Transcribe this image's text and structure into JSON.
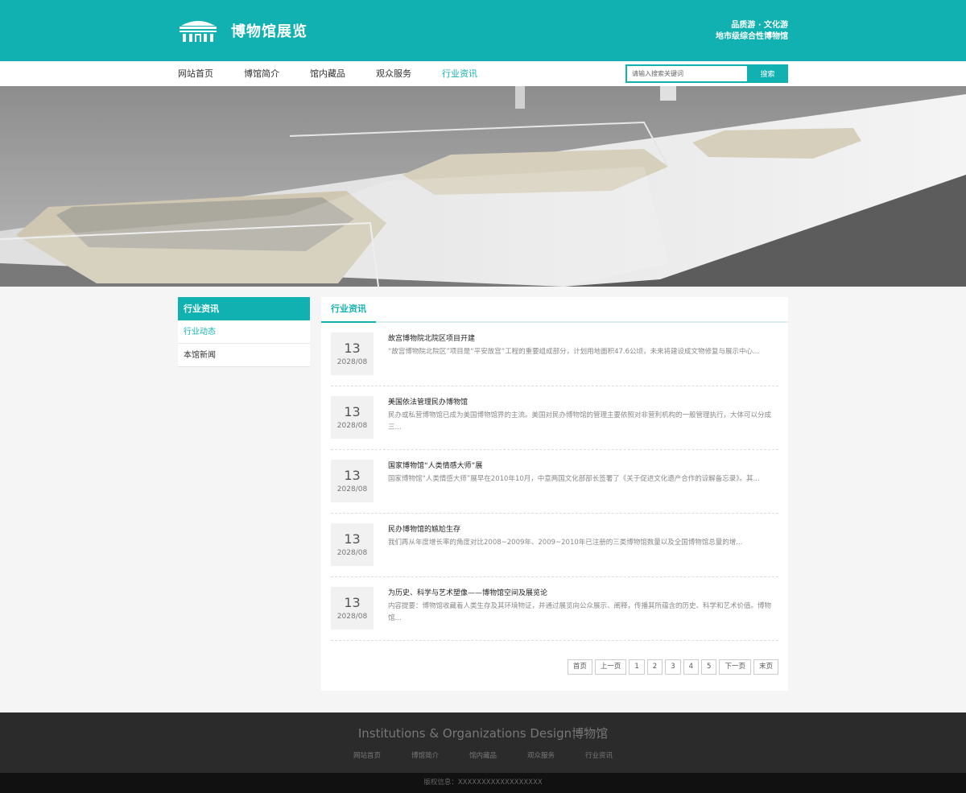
{
  "header": {
    "logo_title": "博物馆展览",
    "slogan_line1": "品质游 · 文化游",
    "slogan_line2": "地市级综合性博物馆"
  },
  "nav": {
    "items": [
      {
        "label": "网站首页"
      },
      {
        "label": "博馆简介"
      },
      {
        "label": "馆内藏品"
      },
      {
        "label": "观众服务"
      },
      {
        "label": "行业资讯"
      }
    ],
    "active_index": 4,
    "search_placeholder": "请输入搜索关键词",
    "search_button": "搜索"
  },
  "sidebar": {
    "title": "行业资讯",
    "items": [
      {
        "label": "行业动态"
      },
      {
        "label": "本馆新闻"
      }
    ]
  },
  "content": {
    "tab_label": "行业资讯",
    "news": [
      {
        "day": "13",
        "ym": "2028/08",
        "title": "故宫博物院北院区项目开建",
        "summary": "“故宫博物院北院区”项目是“平安故宫”工程的重要组成部分，计划用地面积47.6公顷，未来将建设成文物修复与展示中心..."
      },
      {
        "day": "13",
        "ym": "2028/08",
        "title": "美国依法管理民办博物馆",
        "summary": "民办或私营博物馆已成为美国博物馆界的主流。美国对民办博物馆的管理主要依照对非营利机构的一般管理执行，大体可以分成三..."
      },
      {
        "day": "13",
        "ym": "2028/08",
        "title": "国家博物馆“人类情感大师”展",
        "summary": "国家博物馆“人类情感大师”展早在2010年10月，中意两国文化部部长签署了《关于促进文化遗产合作的谅解备忘录》。其..."
      },
      {
        "day": "13",
        "ym": "2028/08",
        "title": "民办博物馆的尴尬生存",
        "summary": "我们再从年度增长率的角度对比2008~2009年、2009~2010年已注册的三类博物馆数量以及全国博物馆总量的增..."
      },
      {
        "day": "13",
        "ym": "2028/08",
        "title": "为历史、科学与艺术塑像——博物馆空间及展览论",
        "summary": "内容提要：博物馆收藏着人类生存及其环境物证，并通过展览向公众展示、阐释，传播其所蕴含的历史、科学和艺术价值。博物馆..."
      }
    ]
  },
  "pager": {
    "first": "首页",
    "prev": "上一页",
    "pages": [
      "1",
      "2",
      "3",
      "4",
      "5"
    ],
    "next": "下一页",
    "last": "末页"
  },
  "footer": {
    "title": "Institutions & Organizations Design博物馆",
    "links": [
      {
        "label": "网站首页"
      },
      {
        "label": "博馆简介"
      },
      {
        "label": "馆内藏品"
      },
      {
        "label": "观众服务"
      },
      {
        "label": "行业资讯"
      }
    ],
    "copyright": "版权信息：XXXXXXXXXXXXXXXXXX"
  },
  "colors": {
    "accent": "#12b1b1",
    "footer_bg": "#2b2b2b",
    "copyright_bg": "#111111"
  }
}
